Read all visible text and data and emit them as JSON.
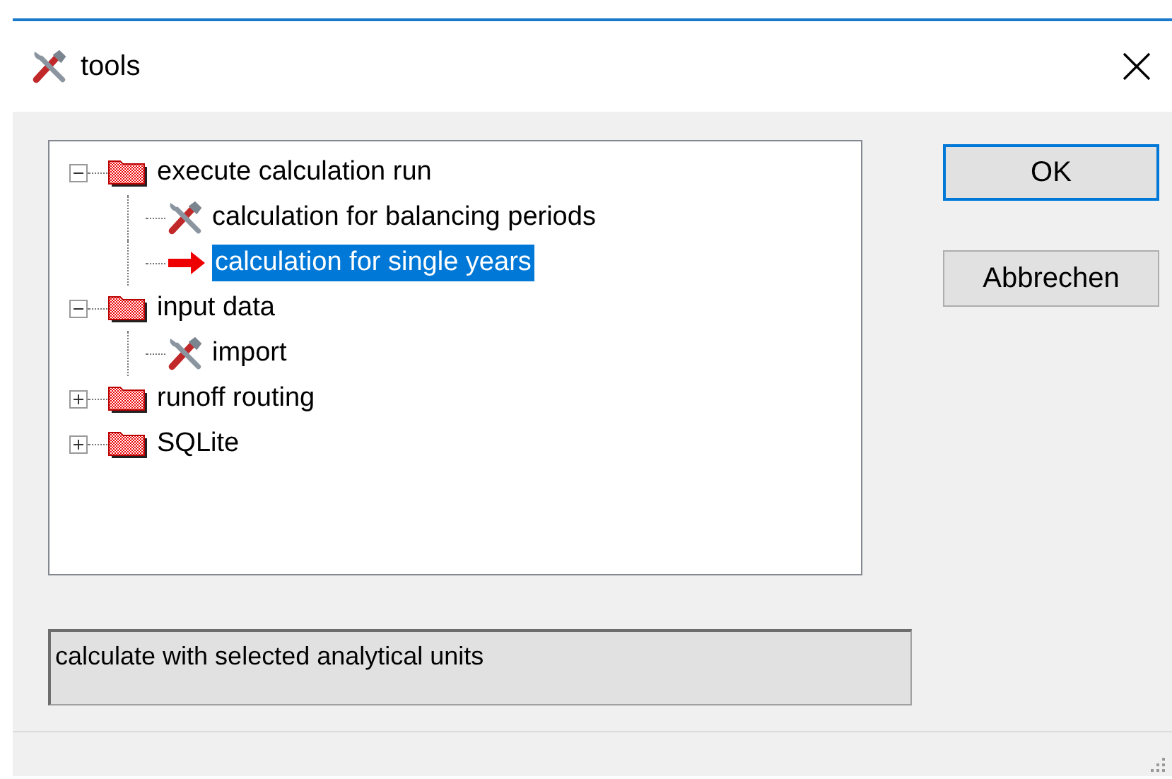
{
  "window": {
    "title": "tools"
  },
  "tree": [
    {
      "label": "execute calculation run",
      "kind": "folder",
      "expanded": true,
      "selected": false,
      "children": [
        {
          "label": "calculation for  balancing periods",
          "kind": "tool",
          "selected": false
        },
        {
          "label": "calculation for single years",
          "kind": "arrow",
          "selected": true
        }
      ]
    },
    {
      "label": "input data",
      "kind": "folder",
      "expanded": true,
      "selected": false,
      "children": [
        {
          "label": "import",
          "kind": "tool",
          "selected": false
        }
      ]
    },
    {
      "label": "runoff routing",
      "kind": "folder",
      "expanded": false,
      "selected": false
    },
    {
      "label": "SQLite",
      "kind": "folder",
      "expanded": false,
      "selected": false
    }
  ],
  "buttons": [
    {
      "label": "OK",
      "default": true
    },
    {
      "label": "Abbrechen",
      "default": false
    }
  ],
  "description": "calculate with selected analytical units"
}
